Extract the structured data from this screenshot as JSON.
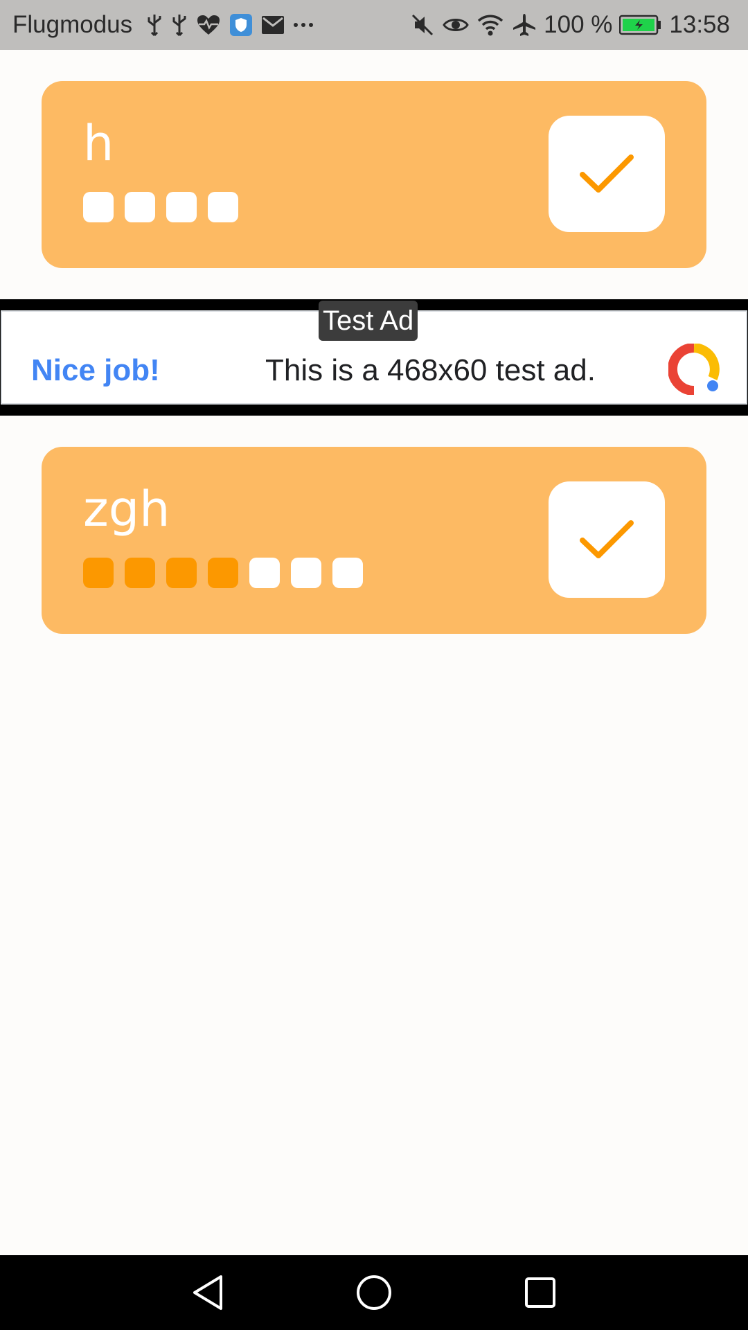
{
  "statusbar": {
    "left_text": "Flugmodus",
    "battery": "100 %",
    "time": "13:58",
    "left_icons": [
      "usb-icon",
      "usb-icon",
      "heartbeat-icon",
      "shield-icon",
      "mail-icon",
      "more-icon"
    ],
    "right_icons": [
      "mute-icon",
      "eye-icon",
      "wifi-icon",
      "airplane-icon",
      "battery-icon"
    ]
  },
  "habits": [
    {
      "title": "h",
      "progress": [
        false,
        false,
        false,
        false
      ],
      "checked_icon": "checkmark-icon"
    },
    {
      "title": "zgh",
      "progress": [
        true,
        true,
        true,
        true,
        false,
        false,
        false
      ],
      "checked_icon": "checkmark-icon"
    }
  ],
  "ad": {
    "tag": "Test Ad",
    "cta": "Nice job!",
    "text": "This is a 468x60 test ad.",
    "logo": "ad-logo-icon"
  },
  "navbar": {
    "back": "back-icon",
    "home": "home-icon",
    "recents": "recents-icon"
  },
  "colors": {
    "card": "#fdba63",
    "accent": "#fc9800",
    "background": "#fdfcfa",
    "cta": "#4285f4"
  }
}
